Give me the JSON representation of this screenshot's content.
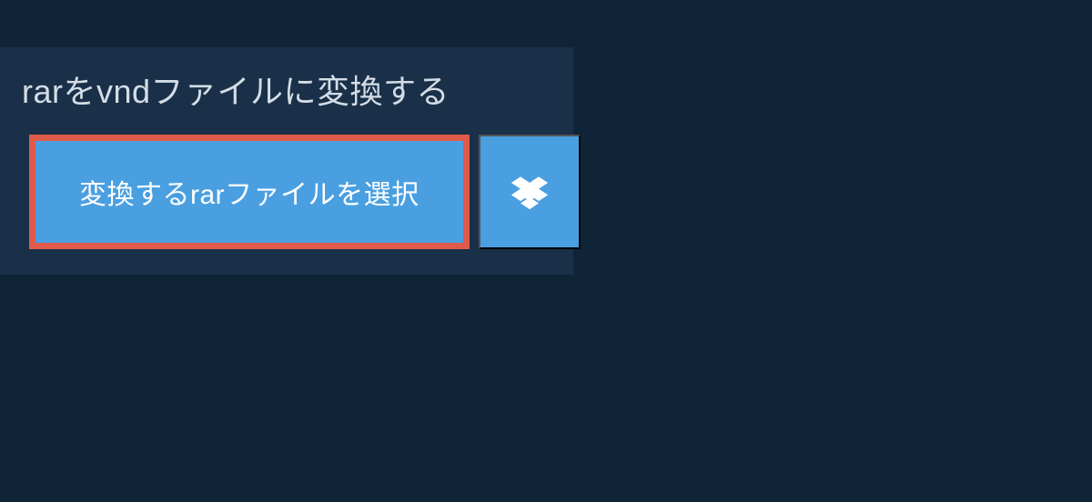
{
  "header": {
    "title": "rarをvndファイルに変換する"
  },
  "actions": {
    "select_file_label": "変換するrarファイルを選択",
    "dropbox_icon": "dropbox-icon"
  },
  "colors": {
    "background": "#0f2437",
    "panel": "#1a3049",
    "button": "#4a9fe0",
    "highlight_border": "#e05a4a",
    "text_light": "#d4dde6"
  }
}
